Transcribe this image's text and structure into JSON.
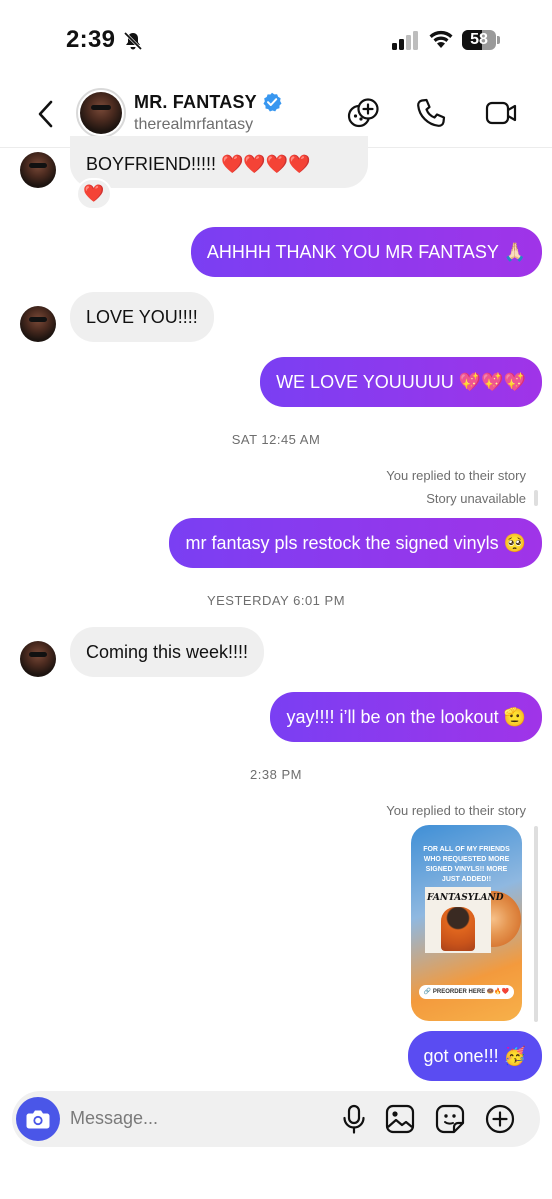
{
  "status_bar": {
    "time": "2:39",
    "battery": "58"
  },
  "header": {
    "name": "MR. FANTASY",
    "handle": "therealmrfantasy"
  },
  "messages": {
    "m1": "BOYFRIEND!!!!! ❤️❤️❤️❤️",
    "m1_reaction": "❤️",
    "m2": "AHHHH THANK YOU MR FANTASY 🙏🏻",
    "m3": "LOVE YOU!!!!",
    "m4": "WE LOVE YOUUUUU 💖💖💖",
    "ts1": "SAT 12:45 AM",
    "reply_note_1": "You replied to their story",
    "story_unavailable": "Story unavailable",
    "m5": "mr fantasy pls restock the signed vinyls 🥺",
    "ts2": "YESTERDAY 6:01 PM",
    "m6": "Coming this week!!!!",
    "m7": "yay!!!! i’ll be on the lookout 🫡",
    "ts3": "2:38 PM",
    "reply_note_2": "You replied to their story",
    "m8": "got one!!! 🥳"
  },
  "story": {
    "text": "FOR ALL OF MY FRIENDS WHO REQUESTED MORE SIGNED VINYLS!! MORE JUST ADDED!!",
    "album_title": "FANTASYLAND",
    "pill": "🔗 PREORDER HERE 🍩🔥❤️"
  },
  "composer": {
    "placeholder": "Message..."
  },
  "icons": {
    "back": "chevron-left-icon",
    "verified": "verified-badge-icon",
    "effects": "effects-icon",
    "call": "phone-icon",
    "video": "video-icon",
    "camera": "camera-icon",
    "mic": "microphone-icon",
    "gallery": "gallery-icon",
    "sticker": "sticker-icon",
    "plus": "plus-icon",
    "bell": "bell-slash-icon"
  },
  "colors": {
    "outgoing_start": "#7a3ff3",
    "outgoing_end": "#a034e8",
    "outgoing_last": "#5a4cf2",
    "incoming": "#efefef",
    "camera_button": "#4a56e8",
    "verified": "#3897f0"
  }
}
